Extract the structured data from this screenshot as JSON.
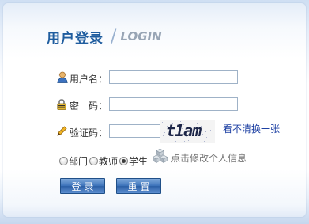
{
  "header": {
    "title_cn": "用户登录",
    "title_en": "LOGIN"
  },
  "form": {
    "username_label": "用户名：",
    "password_label": "密　码：",
    "captcha_label": "验证码：",
    "username_value": "",
    "password_value": "",
    "captcha_value": "",
    "captcha_image_text": "t1am",
    "captcha_refresh": "看不清换一张"
  },
  "roles": {
    "options": [
      "部门",
      "教师",
      "学生"
    ],
    "selected": "学生"
  },
  "modify_info": "点击修改个人信息",
  "buttons": {
    "login": "登录",
    "reset": "重置"
  },
  "icons": {
    "username": "user-icon",
    "password": "lock-icon",
    "captcha": "pencil-icon",
    "modify": "cubes-icon"
  },
  "colors": {
    "title": "#1f5d9f",
    "button": "#3e74bb",
    "link": "#1b3ea2"
  }
}
